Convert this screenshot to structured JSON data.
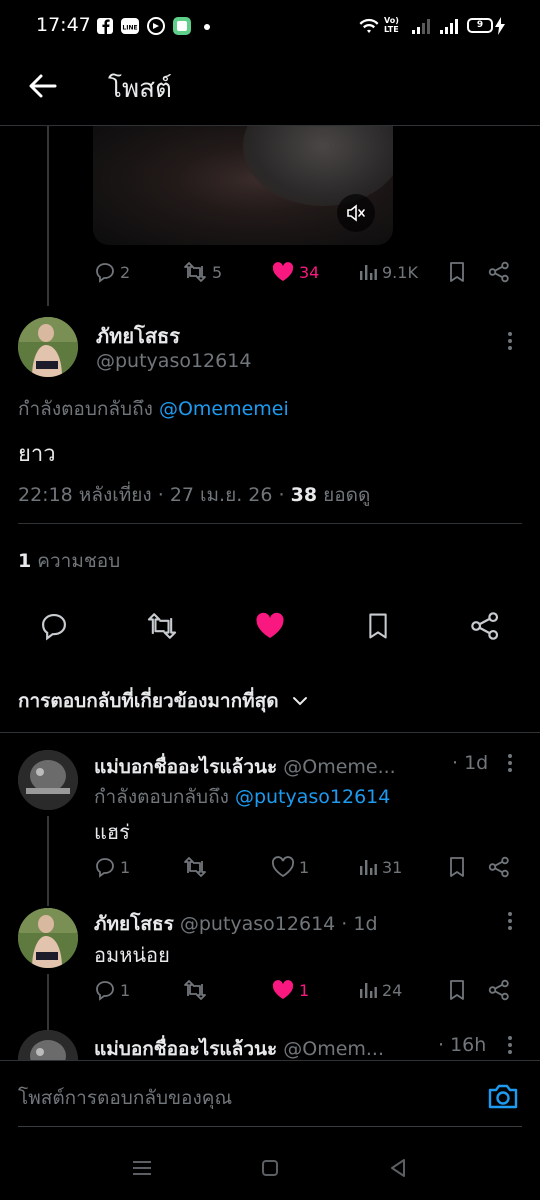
{
  "status_bar": {
    "time": "17:47",
    "volte_label": "Vo)\nLTE",
    "battery": "9"
  },
  "header": {
    "title": "โพสต์"
  },
  "media_post": {
    "actions": {
      "replies": "2",
      "reposts": "5",
      "likes": "34",
      "views": "9.1K"
    },
    "liked": true
  },
  "main_tweet": {
    "name": "ภัทยโสธร",
    "handle": "@putyaso12614",
    "reply_prefix": "กำลังตอบกลับถึง",
    "reply_to": "@Omememei",
    "text": "ยาว",
    "time": "22:18 หลังเที่ยง",
    "date": "27 เม.ย. 26",
    "views_count": "38",
    "views_label": "ยอดดู",
    "likes_count": "1",
    "likes_label": "ความชอบ"
  },
  "sort": {
    "label": "การตอบกลับที่เกี่ยวข้องมากที่สุด"
  },
  "replies": [
    {
      "name": "แม่บอกชื่ออะไรแล้วนะ",
      "handle": "@Omeme...",
      "time": "1d",
      "reply_prefix": "กำลังตอบกลับถึง",
      "reply_to": "@putyaso12614",
      "text": "แฮร่",
      "replies": "1",
      "reposts": "",
      "likes": "1",
      "views": "31",
      "liked": false
    },
    {
      "name": "ภัทยโสธร",
      "handle": "@putyaso12614",
      "time": "1d",
      "text": "อมหน่อย",
      "replies": "1",
      "reposts": "",
      "likes": "1",
      "views": "24",
      "liked": true
    },
    {
      "name": "แม่บอกชื่ออะไรแล้วนะ",
      "handle": "@Omem...",
      "time": "16h"
    }
  ],
  "reply_bar": {
    "placeholder": "โพสต์การตอบกลับของคุณ"
  },
  "colors": {
    "like": "#f91880",
    "link": "#1d9bf0",
    "muted": "#71767b",
    "text": "#e7e9ea"
  }
}
